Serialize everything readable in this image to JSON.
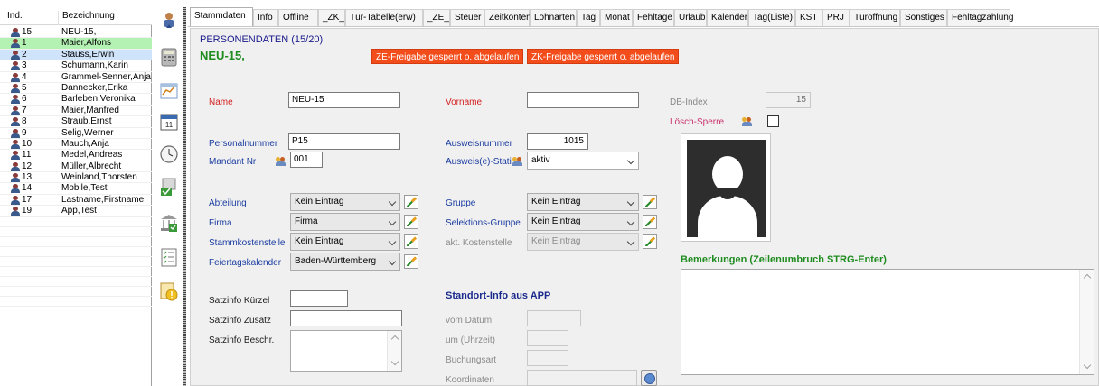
{
  "list": {
    "header": {
      "col1": "Ind.",
      "col2": "Bezeichnung"
    },
    "rows": [
      {
        "ind": "15",
        "name": "NEU-15,",
        "state": "normal"
      },
      {
        "ind": "1",
        "name": "Maier,Alfons",
        "state": "green"
      },
      {
        "ind": "2",
        "name": "Stauss,Erwin",
        "state": "blue"
      },
      {
        "ind": "3",
        "name": "Schumann,Karin",
        "state": "normal"
      },
      {
        "ind": "4",
        "name": "Grammel-Senner,Anja",
        "state": "normal"
      },
      {
        "ind": "5",
        "name": "Dannecker,Erika",
        "state": "normal"
      },
      {
        "ind": "6",
        "name": "Barleben,Veronika",
        "state": "normal"
      },
      {
        "ind": "7",
        "name": "Maier,Manfred",
        "state": "normal"
      },
      {
        "ind": "8",
        "name": "Straub,Ernst",
        "state": "normal"
      },
      {
        "ind": "9",
        "name": "Selig,Werner",
        "state": "normal"
      },
      {
        "ind": "10",
        "name": "Mauch,Anja",
        "state": "normal"
      },
      {
        "ind": "11",
        "name": "Medel,Andreas",
        "state": "normal"
      },
      {
        "ind": "12",
        "name": "Müller,Albrecht",
        "state": "normal"
      },
      {
        "ind": "13",
        "name": "Weinland,Thorsten",
        "state": "normal"
      },
      {
        "ind": "14",
        "name": "Mobile,Test",
        "state": "normal"
      },
      {
        "ind": "17",
        "name": "Lastname,Firstname",
        "state": "normal"
      },
      {
        "ind": "19",
        "name": "App,Test",
        "state": "normal"
      }
    ]
  },
  "sidebar_icons": [
    "person-upload-icon",
    "calculator-icon",
    "chart-icon",
    "calendar-icon",
    "clock-icon",
    "approval-icon",
    "bank-icon",
    "checklist-icon",
    "warning-document-icon"
  ],
  "calendar_icon_text": "11",
  "tabs": [
    "Stammdaten",
    "Info",
    "Offline",
    "_ZK_",
    "Tür-Tabelle(erw)",
    "_ZE_",
    "Steuer",
    "Zeitkonten",
    "Lohnarten",
    "Tag",
    "Monat",
    "Fehltage",
    "Urlaub",
    "Kalender",
    "Tag(Liste)",
    "KST",
    "PRJ",
    "Türöffnung",
    "Sonstiges",
    "Fehltagzahlung"
  ],
  "header": {
    "section_title": "PERSONENDATEN (15/20)",
    "employee_name": "NEU-15,",
    "ze_badge": "ZE-Freigabe gesperrt o. abgelaufen",
    "zk_badge": "ZK-Freigabe gesperrt o. abgelaufen"
  },
  "form": {
    "name_label": "Name",
    "name_value": "NEU-15",
    "vorname_label": "Vorname",
    "vorname_value": "",
    "dbindex_label": "DB-Index",
    "dbindex_value": "15",
    "loesch_label": "Lösch-Sperre",
    "personalnummer_label": "Personalnummer",
    "personalnummer_value": "P15",
    "ausweisnummer_label": "Ausweisnummer",
    "ausweisnummer_value": "1015",
    "mandant_label": "Mandant Nr",
    "mandant_value": "001",
    "ausweisstati_label": "Ausweis(e)-Stati",
    "ausweisstati_value": "aktiv",
    "abteilung_label": "Abteilung",
    "abteilung_value": "Kein Eintrag",
    "gruppe_label": "Gruppe",
    "gruppe_value": "Kein Eintrag",
    "firma_label": "Firma",
    "firma_value": "Firma",
    "selektion_label": "Selektions-Gruppe",
    "selektion_value": "Kein Eintrag",
    "stammkst_label": "Stammkostenstelle",
    "stammkst_value": "Kein Eintrag",
    "aktkst_label": "akt. Kostenstelle",
    "aktkst_value": "Kein Eintrag",
    "feiertag_label": "Feiertagskalender",
    "feiertag_value": "Baden-Württemberg",
    "bemerkungen_label": "Bemerkungen (Zeilenumbruch STRG-Enter)",
    "satz_kuerzel_label": "Satzinfo Kürzel",
    "satz_kuerzel_value": "",
    "satz_zusatz_label": "Satzinfo Zusatz",
    "satz_zusatz_value": "",
    "satz_beschr_label": "Satzinfo Beschr.",
    "standort_title": "Standort-Info aus APP",
    "vom_datum_label": "vom Datum",
    "uhrzeit_label": "um (Uhrzeit)",
    "buchungsart_label": "Buchungsart",
    "koordinaten_label": "Koordinaten"
  },
  "colors": {
    "accent_green": "#1e8c1e",
    "badge_red": "#f24d1b",
    "label_red": "#d42020",
    "label_blue": "#1a3ca0",
    "selected_green": "#b4f2b4",
    "selected_blue": "#cfe3fb"
  }
}
